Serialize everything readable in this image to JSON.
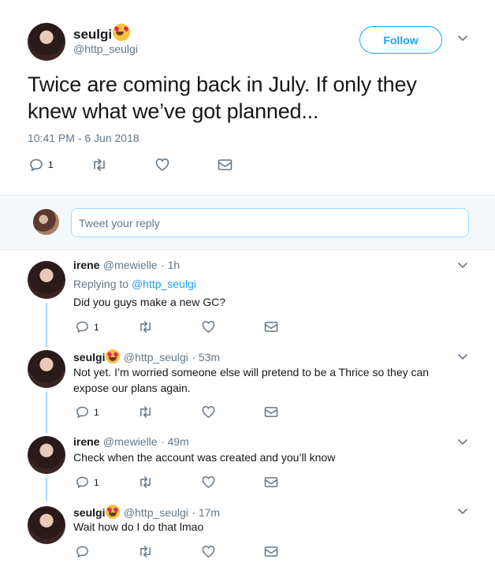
{
  "main_tweet": {
    "display_name": "seulgi",
    "handle": "@http_seulgi",
    "follow_label": "Follow",
    "text": "Twice are coming back in July. If only they knew what we’ve got planned...",
    "timestamp": "10:41 PM - 6 Jun 2018",
    "reply_count": "1"
  },
  "reply_box": {
    "placeholder": "Tweet your reply"
  },
  "replies": [
    {
      "display_name": "irene",
      "handle": "@mewielle",
      "time": "· 1h",
      "replying_prefix": "Replying to ",
      "replying_to": "@http_seulgi",
      "text": "Did you guys make a new GC?",
      "reply_count": "1"
    },
    {
      "display_name": "seulgi",
      "handle": "@http_seulgi",
      "time": "· 53m",
      "text": "Not yet. I’m worried someone else will pretend to be a Thrice so they can expose our plans again.",
      "reply_count": "1"
    },
    {
      "display_name": "irene",
      "handle": "@mewielle",
      "time": "· 49m",
      "text": "Check when the account was created and you’ll know",
      "reply_count": "1"
    },
    {
      "display_name": "seulgi",
      "handle": "@http_seulgi",
      "time": "· 17m",
      "text": "Wait how do I do that lmao",
      "reply_count": ""
    }
  ],
  "icons": {
    "reply": "reply-icon",
    "retweet": "retweet-icon",
    "like": "heart-icon",
    "dm": "envelope-icon",
    "more": "chevron-down-icon",
    "emoji": "heart-eyes-emoji-icon"
  },
  "colors": {
    "accent": "#1da1f2",
    "thread_line": "#a4d9f9",
    "muted_text": "#657786",
    "text": "#14171a"
  }
}
